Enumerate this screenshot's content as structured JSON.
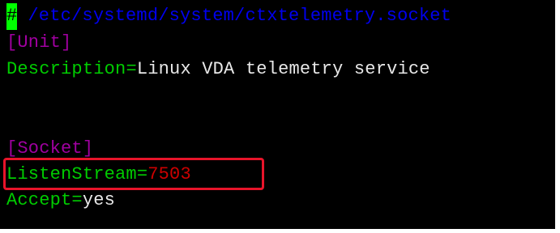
{
  "terminal": {
    "cursor_char": "#",
    "comment_path": " /etc/systemd/system/ctxtelemetry.socket",
    "unit_header": "[Unit]",
    "description_key": "Description",
    "description_eq": "=",
    "description_value": "Linux VDA telemetry service",
    "blank_line": "",
    "socket_header": "[Socket]",
    "listen_key": "ListenStream",
    "listen_eq": "=",
    "listen_value": "7503",
    "accept_key": "Accept",
    "accept_eq": "=",
    "accept_value": "yes"
  },
  "colors": {
    "background": "#000000",
    "comment": "#0000ee",
    "section": "#a000a0",
    "key": "#00cc00",
    "value": "#e8e8e8",
    "number": "#cc0000",
    "highlight_border": "#e8142a",
    "cursor": "#00ff00"
  }
}
